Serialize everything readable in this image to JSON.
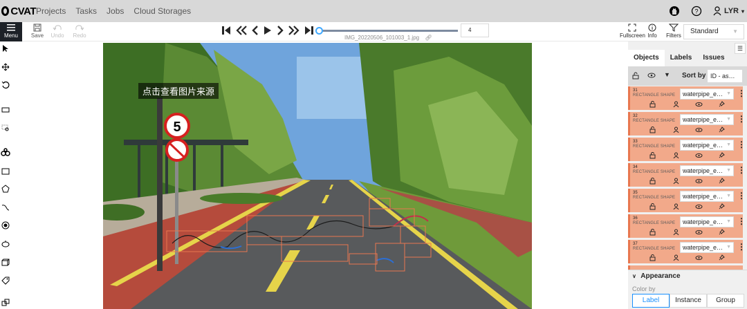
{
  "app": {
    "logo_text": "CVAT"
  },
  "nav": {
    "links": [
      "Projects",
      "Tasks",
      "Jobs",
      "Cloud Storages"
    ],
    "user": "LYR"
  },
  "toolbar": {
    "menu_label": "Menu",
    "save_label": "Save",
    "undo_label": "Undo",
    "redo_label": "Redo",
    "filename": "IMG_20220506_101003_1.jpg",
    "frame_number": "4",
    "fullscreen_label": "Fullscreen",
    "info_label": "Info",
    "filters_label": "Filters",
    "workspace": "Standard"
  },
  "canvas": {
    "watermark_text": "点击查看图片来源",
    "sign_speed_limit": "5"
  },
  "panel": {
    "tabs": [
      "Objects",
      "Labels",
      "Issues"
    ],
    "sort_by_label": "Sort by",
    "sort_value": "ID - as…",
    "objects": [
      {
        "id": "31",
        "type": "RECTANGLE SHAPE",
        "label": "waterpipe_e…"
      },
      {
        "id": "32",
        "type": "RECTANGLE SHAPE",
        "label": "waterpipe_e…"
      },
      {
        "id": "33",
        "type": "RECTANGLE SHAPE",
        "label": "waterpipe_e…"
      },
      {
        "id": "34",
        "type": "RECTANGLE SHAPE",
        "label": "waterpipe_e…"
      },
      {
        "id": "35",
        "type": "RECTANGLE SHAPE",
        "label": "waterpipe_e…"
      },
      {
        "id": "36",
        "type": "RECTANGLE SHAPE",
        "label": "waterpipe_e…"
      },
      {
        "id": "37",
        "type": "RECTANGLE SHAPE",
        "label": "waterpipe_e…"
      }
    ],
    "appearance": {
      "title": "Appearance",
      "color_by_label": "Color by",
      "options": [
        "Label",
        "Instance",
        "Group"
      ],
      "selected": "Label"
    }
  },
  "colors": {
    "object_card_bg": "#f2a98a",
    "object_card_border": "#e8774f",
    "accent": "#1890ff"
  }
}
